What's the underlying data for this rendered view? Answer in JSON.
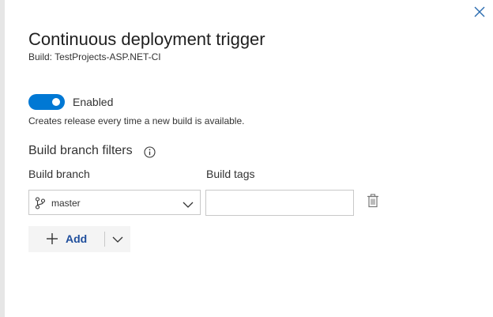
{
  "dialog": {
    "title": "Continuous deployment trigger",
    "subtitle": "Build: TestProjects-ASP.NET-CI"
  },
  "trigger": {
    "enabled": true,
    "toggle_label": "Enabled",
    "description": "Creates release every time a new build is available."
  },
  "filters": {
    "heading": "Build branch filters",
    "branch_label": "Build branch",
    "tags_label": "Build tags",
    "branch_value": "master",
    "tags_value": "",
    "tags_placeholder": ""
  },
  "actions": {
    "add_label": "Add"
  },
  "colors": {
    "accent": "#0078d4",
    "link": "#1f4e9c"
  },
  "icons": {
    "close": "close-icon",
    "info": "info-icon",
    "branch": "branch-icon",
    "chevron": "chevron-down-icon",
    "trash": "trash-icon",
    "plus": "plus-icon"
  }
}
